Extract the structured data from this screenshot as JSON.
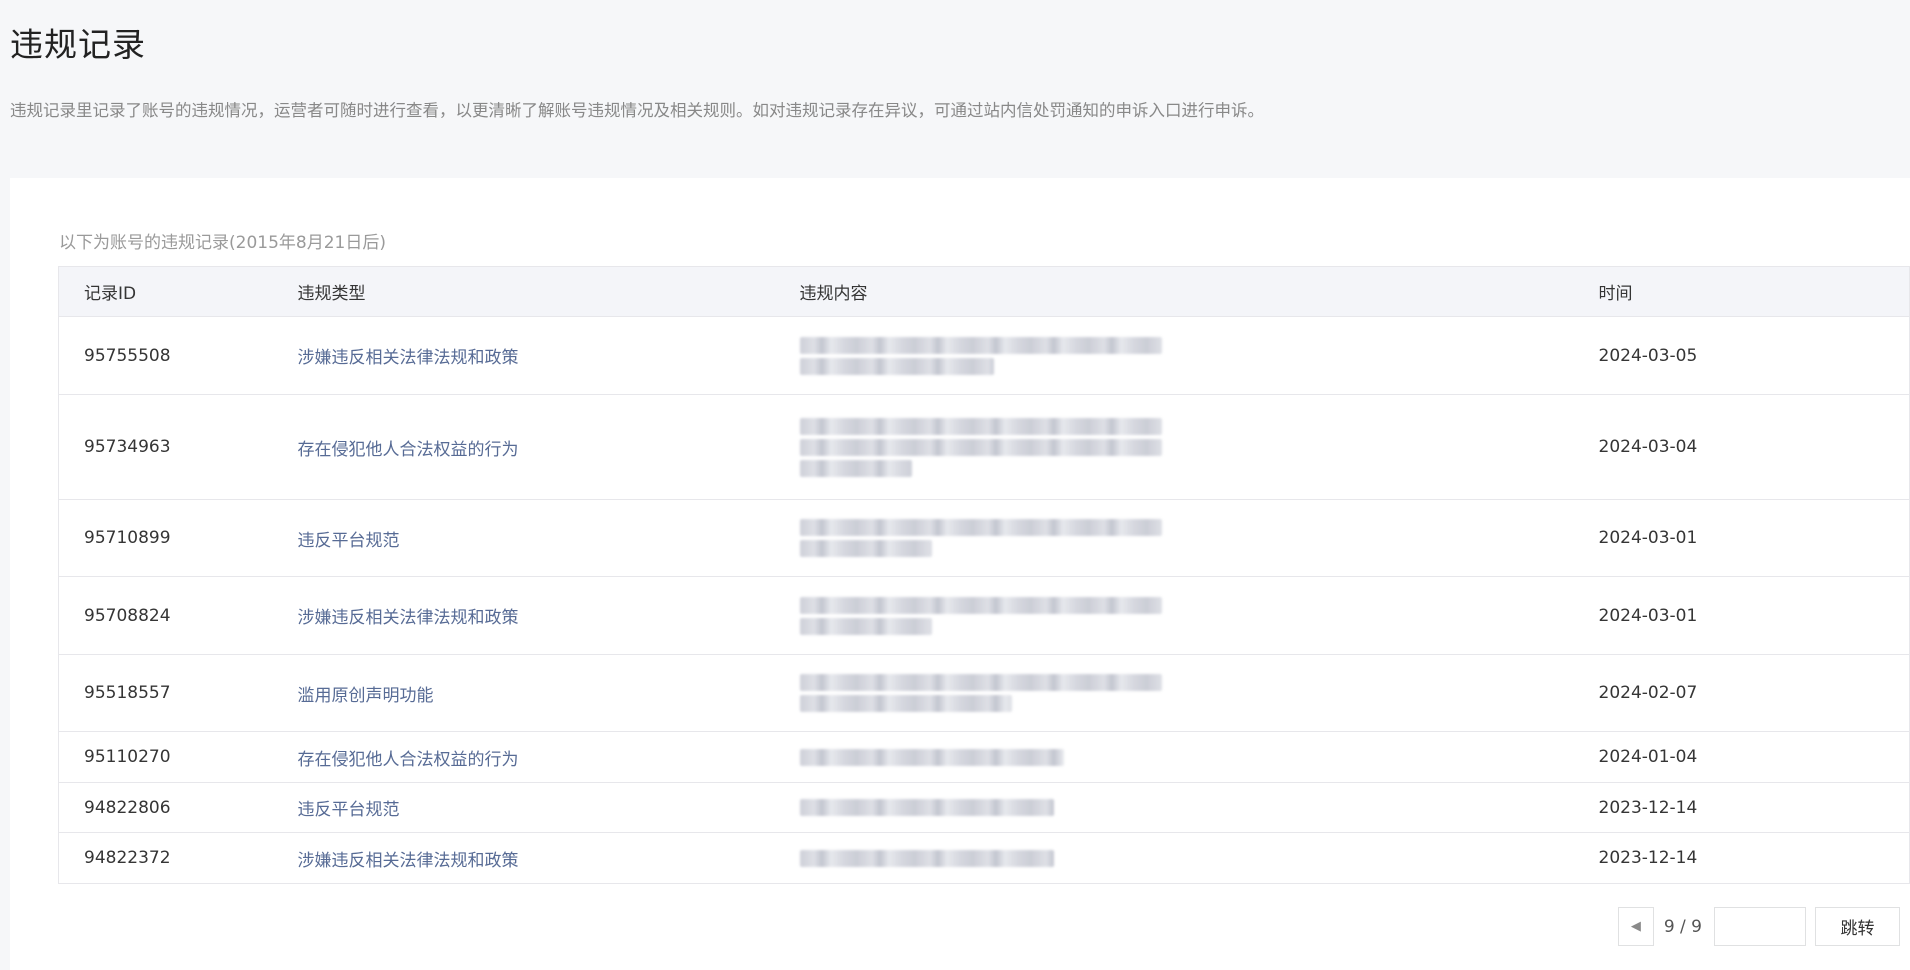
{
  "header": {
    "title": "违规记录",
    "description": "违规记录里记录了账号的违规情况，运营者可随时进行查看，以更清晰了解账号违规情况及相关规则。如对违规记录存在异议，可通过站内信处罚通知的申诉入口进行申诉。"
  },
  "records": {
    "subtitle": "以下为账号的违规记录(2015年8月21日后)",
    "columns": [
      "记录ID",
      "违规类型",
      "违规内容",
      "时间"
    ],
    "rows": [
      {
        "id": "95755508",
        "type": "涉嫌违反相关法律法规和政策",
        "time": "2024-03-05"
      },
      {
        "id": "95734963",
        "type": "存在侵犯他人合法权益的行为",
        "time": "2024-03-04"
      },
      {
        "id": "95710899",
        "type": "违反平台规范",
        "time": "2024-03-01"
      },
      {
        "id": "95708824",
        "type": "涉嫌违反相关法律法规和政策",
        "time": "2024-03-01"
      },
      {
        "id": "95518557",
        "type": "滥用原创声明功能",
        "time": "2024-02-07"
      },
      {
        "id": "95110270",
        "type": "存在侵犯他人合法权益的行为",
        "time": "2024-01-04"
      },
      {
        "id": "94822806",
        "type": "违反平台规范",
        "time": "2023-12-14"
      },
      {
        "id": "94822372",
        "type": "涉嫌违反相关法律法规和政策",
        "time": "2023-12-14"
      }
    ]
  },
  "pagination": {
    "page_indicator": "9 / 9",
    "jump_input_value": "",
    "jump_button_label": "跳转",
    "prev_icon": "caret-left-icon"
  }
}
